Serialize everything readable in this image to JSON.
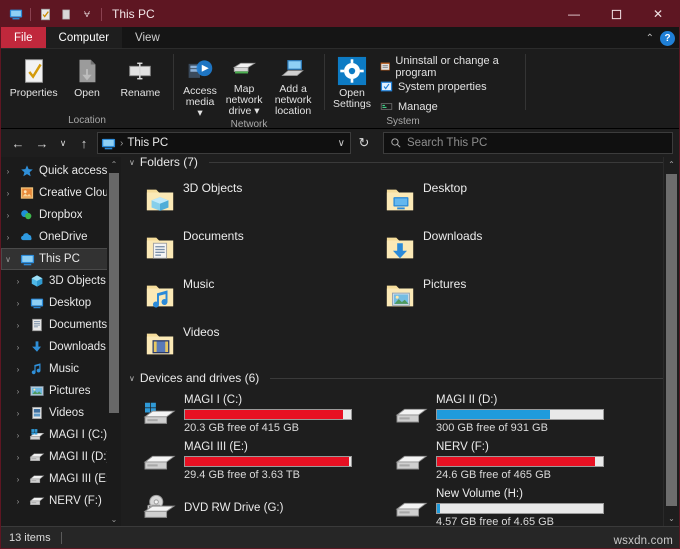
{
  "window": {
    "title": "This PC",
    "quick_access_icons": [
      "this-pc-icon",
      "properties-icon",
      "new-folder-icon"
    ],
    "qat_dropdown": "⩝",
    "minimize": "—",
    "maximize": "☐",
    "close": "✕"
  },
  "tabs": [
    {
      "label": "File",
      "type": "file"
    },
    {
      "label": "Computer",
      "type": "active"
    },
    {
      "label": "View",
      "type": "normal"
    }
  ],
  "tabbar_right": {
    "collapse_ribbon": "⌃",
    "help": "?"
  },
  "ribbon": {
    "groups": [
      {
        "title": "Location",
        "buttons": [
          {
            "label": "Properties",
            "icon": "properties-icon"
          },
          {
            "label": "Open",
            "icon": "open-icon"
          },
          {
            "label": "Rename",
            "icon": "rename-icon"
          }
        ]
      },
      {
        "title": "Network",
        "buttons": [
          {
            "label": "Access\nmedia ▾",
            "icon": "access-media-icon"
          },
          {
            "label": "Map network\ndrive ▾",
            "icon": "map-network-drive-icon"
          },
          {
            "label": "Add a network\nlocation",
            "icon": "add-network-location-icon"
          }
        ]
      },
      {
        "title": "System",
        "big_button": {
          "label": "Open\nSettings",
          "icon": "settings-gear-icon"
        },
        "small_buttons": [
          {
            "label": "Uninstall or change a program",
            "icon": "uninstall-icon"
          },
          {
            "label": "System properties",
            "icon": "system-properties-icon"
          },
          {
            "label": "Manage",
            "icon": "manage-icon"
          }
        ]
      }
    ]
  },
  "navbar": {
    "back": "←",
    "forward": "→",
    "recent": "∨",
    "up": "↑",
    "breadcrumb_icon": "this-pc-icon",
    "breadcrumb_sep": "›",
    "breadcrumb": "This PC",
    "dropdown": "∨",
    "refresh": "↻",
    "search_icon": "search-icon",
    "search_placeholder": "Search This PC"
  },
  "sidebar": {
    "items": [
      {
        "label": "Quick access",
        "icon": "star-icon",
        "level": 1,
        "chevron": "›",
        "selected": false
      },
      {
        "label": "Creative Cloud Fil",
        "icon": "creative-cloud-icon",
        "level": 1,
        "chevron": "›",
        "selected": false
      },
      {
        "label": "Dropbox",
        "icon": "dropbox-icon",
        "level": 1,
        "chevron": "›",
        "selected": false
      },
      {
        "label": "OneDrive",
        "icon": "onedrive-icon",
        "level": 1,
        "chevron": "›",
        "selected": false
      },
      {
        "label": "This PC",
        "icon": "this-pc-icon",
        "level": 1,
        "chevron": "∨",
        "selected": true
      },
      {
        "label": "3D Objects",
        "icon": "3d-objects-icon",
        "level": 2,
        "chevron": "›",
        "selected": false
      },
      {
        "label": "Desktop",
        "icon": "desktop-icon",
        "level": 2,
        "chevron": "›",
        "selected": false
      },
      {
        "label": "Documents",
        "icon": "documents-icon",
        "level": 2,
        "chevron": "›",
        "selected": false
      },
      {
        "label": "Downloads",
        "icon": "downloads-icon",
        "level": 2,
        "chevron": "›",
        "selected": false
      },
      {
        "label": "Music",
        "icon": "music-icon",
        "level": 2,
        "chevron": "›",
        "selected": false
      },
      {
        "label": "Pictures",
        "icon": "pictures-icon",
        "level": 2,
        "chevron": "›",
        "selected": false
      },
      {
        "label": "Videos",
        "icon": "videos-icon",
        "level": 2,
        "chevron": "›",
        "selected": false
      },
      {
        "label": "MAGI I (C:)",
        "icon": "windows-drive-icon",
        "level": 2,
        "chevron": "›",
        "selected": false
      },
      {
        "label": "MAGI II (D:)",
        "icon": "drive-icon",
        "level": 2,
        "chevron": "›",
        "selected": false
      },
      {
        "label": "MAGI III (E:)",
        "icon": "drive-icon",
        "level": 2,
        "chevron": "›",
        "selected": false
      },
      {
        "label": "NERV (F:)",
        "icon": "drive-icon",
        "level": 2,
        "chevron": "›",
        "selected": false
      }
    ],
    "scroll_up": "⌃",
    "scroll_down": "⌄"
  },
  "content": {
    "folders_group": {
      "chevron": "∨",
      "title": "Folders (7)",
      "items": [
        {
          "label": "3D Objects",
          "icon": "folder-3d-objects-icon"
        },
        {
          "label": "Desktop",
          "icon": "folder-desktop-icon"
        },
        {
          "label": "Documents",
          "icon": "folder-documents-icon"
        },
        {
          "label": "Downloads",
          "icon": "folder-downloads-icon"
        },
        {
          "label": "Music",
          "icon": "folder-music-icon"
        },
        {
          "label": "Pictures",
          "icon": "folder-pictures-icon"
        },
        {
          "label": "Videos",
          "icon": "folder-videos-icon"
        }
      ]
    },
    "drives_group": {
      "chevron": "∨",
      "title": "Devices and drives (6)",
      "items": [
        {
          "name": "MAGI I (C:)",
          "free": "20.3 GB free of 415 GB",
          "percent_used": 95,
          "bar_color": "#e81123",
          "icon": "windows-drive-icon",
          "has_bar": true
        },
        {
          "name": "MAGI II (D:)",
          "free": "300 GB free of 931 GB",
          "percent_used": 68,
          "bar_color": "#1f9bdc",
          "icon": "drive-icon",
          "has_bar": true
        },
        {
          "name": "MAGI III (E:)",
          "free": "29.4 GB free of 3.63 TB",
          "percent_used": 99,
          "bar_color": "#e81123",
          "icon": "drive-icon",
          "has_bar": true
        },
        {
          "name": "NERV (F:)",
          "free": "24.6 GB free of 465 GB",
          "percent_used": 95,
          "bar_color": "#e81123",
          "icon": "drive-icon",
          "has_bar": true
        },
        {
          "name": "DVD RW Drive (G:)",
          "free": "",
          "percent_used": 0,
          "bar_color": "#1f9bdc",
          "icon": "dvd-drive-icon",
          "has_bar": false
        },
        {
          "name": "New Volume (H:)",
          "free": "4.57 GB free of 4.65 GB",
          "percent_used": 2,
          "bar_color": "#1f9bdc",
          "icon": "drive-icon",
          "has_bar": true
        }
      ]
    },
    "scroll_up": "⌃",
    "scroll_down": "⌄"
  },
  "statusbar": {
    "item_count": "13 items",
    "watermark": "wsxdn.com"
  },
  "colors": {
    "titlebar": "#5e1622",
    "file_tab": "#c0283c",
    "accent_blue": "#1f9bdc",
    "warning_red": "#e81123",
    "bar_track": "#e9e9e9"
  }
}
